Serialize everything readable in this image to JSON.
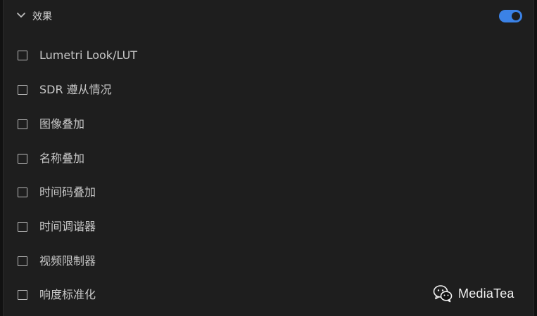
{
  "section": {
    "title": "效果",
    "enabled": true,
    "expanded": true
  },
  "effects": [
    {
      "label": "Lumetri Look/LUT",
      "checked": false
    },
    {
      "label": "SDR 遵从情况",
      "checked": false
    },
    {
      "label": "图像叠加",
      "checked": false
    },
    {
      "label": "名称叠加",
      "checked": false
    },
    {
      "label": "时间码叠加",
      "checked": false
    },
    {
      "label": "时间调谐器",
      "checked": false
    },
    {
      "label": "视频限制器",
      "checked": false
    },
    {
      "label": "响度标准化",
      "checked": false
    }
  ],
  "watermark": {
    "text": "MediaTea",
    "icon": "wechat-icon"
  },
  "colors": {
    "panel": "#1e1e1e",
    "toggle_on": "#3b82e6",
    "text": "#c8c8c8"
  }
}
